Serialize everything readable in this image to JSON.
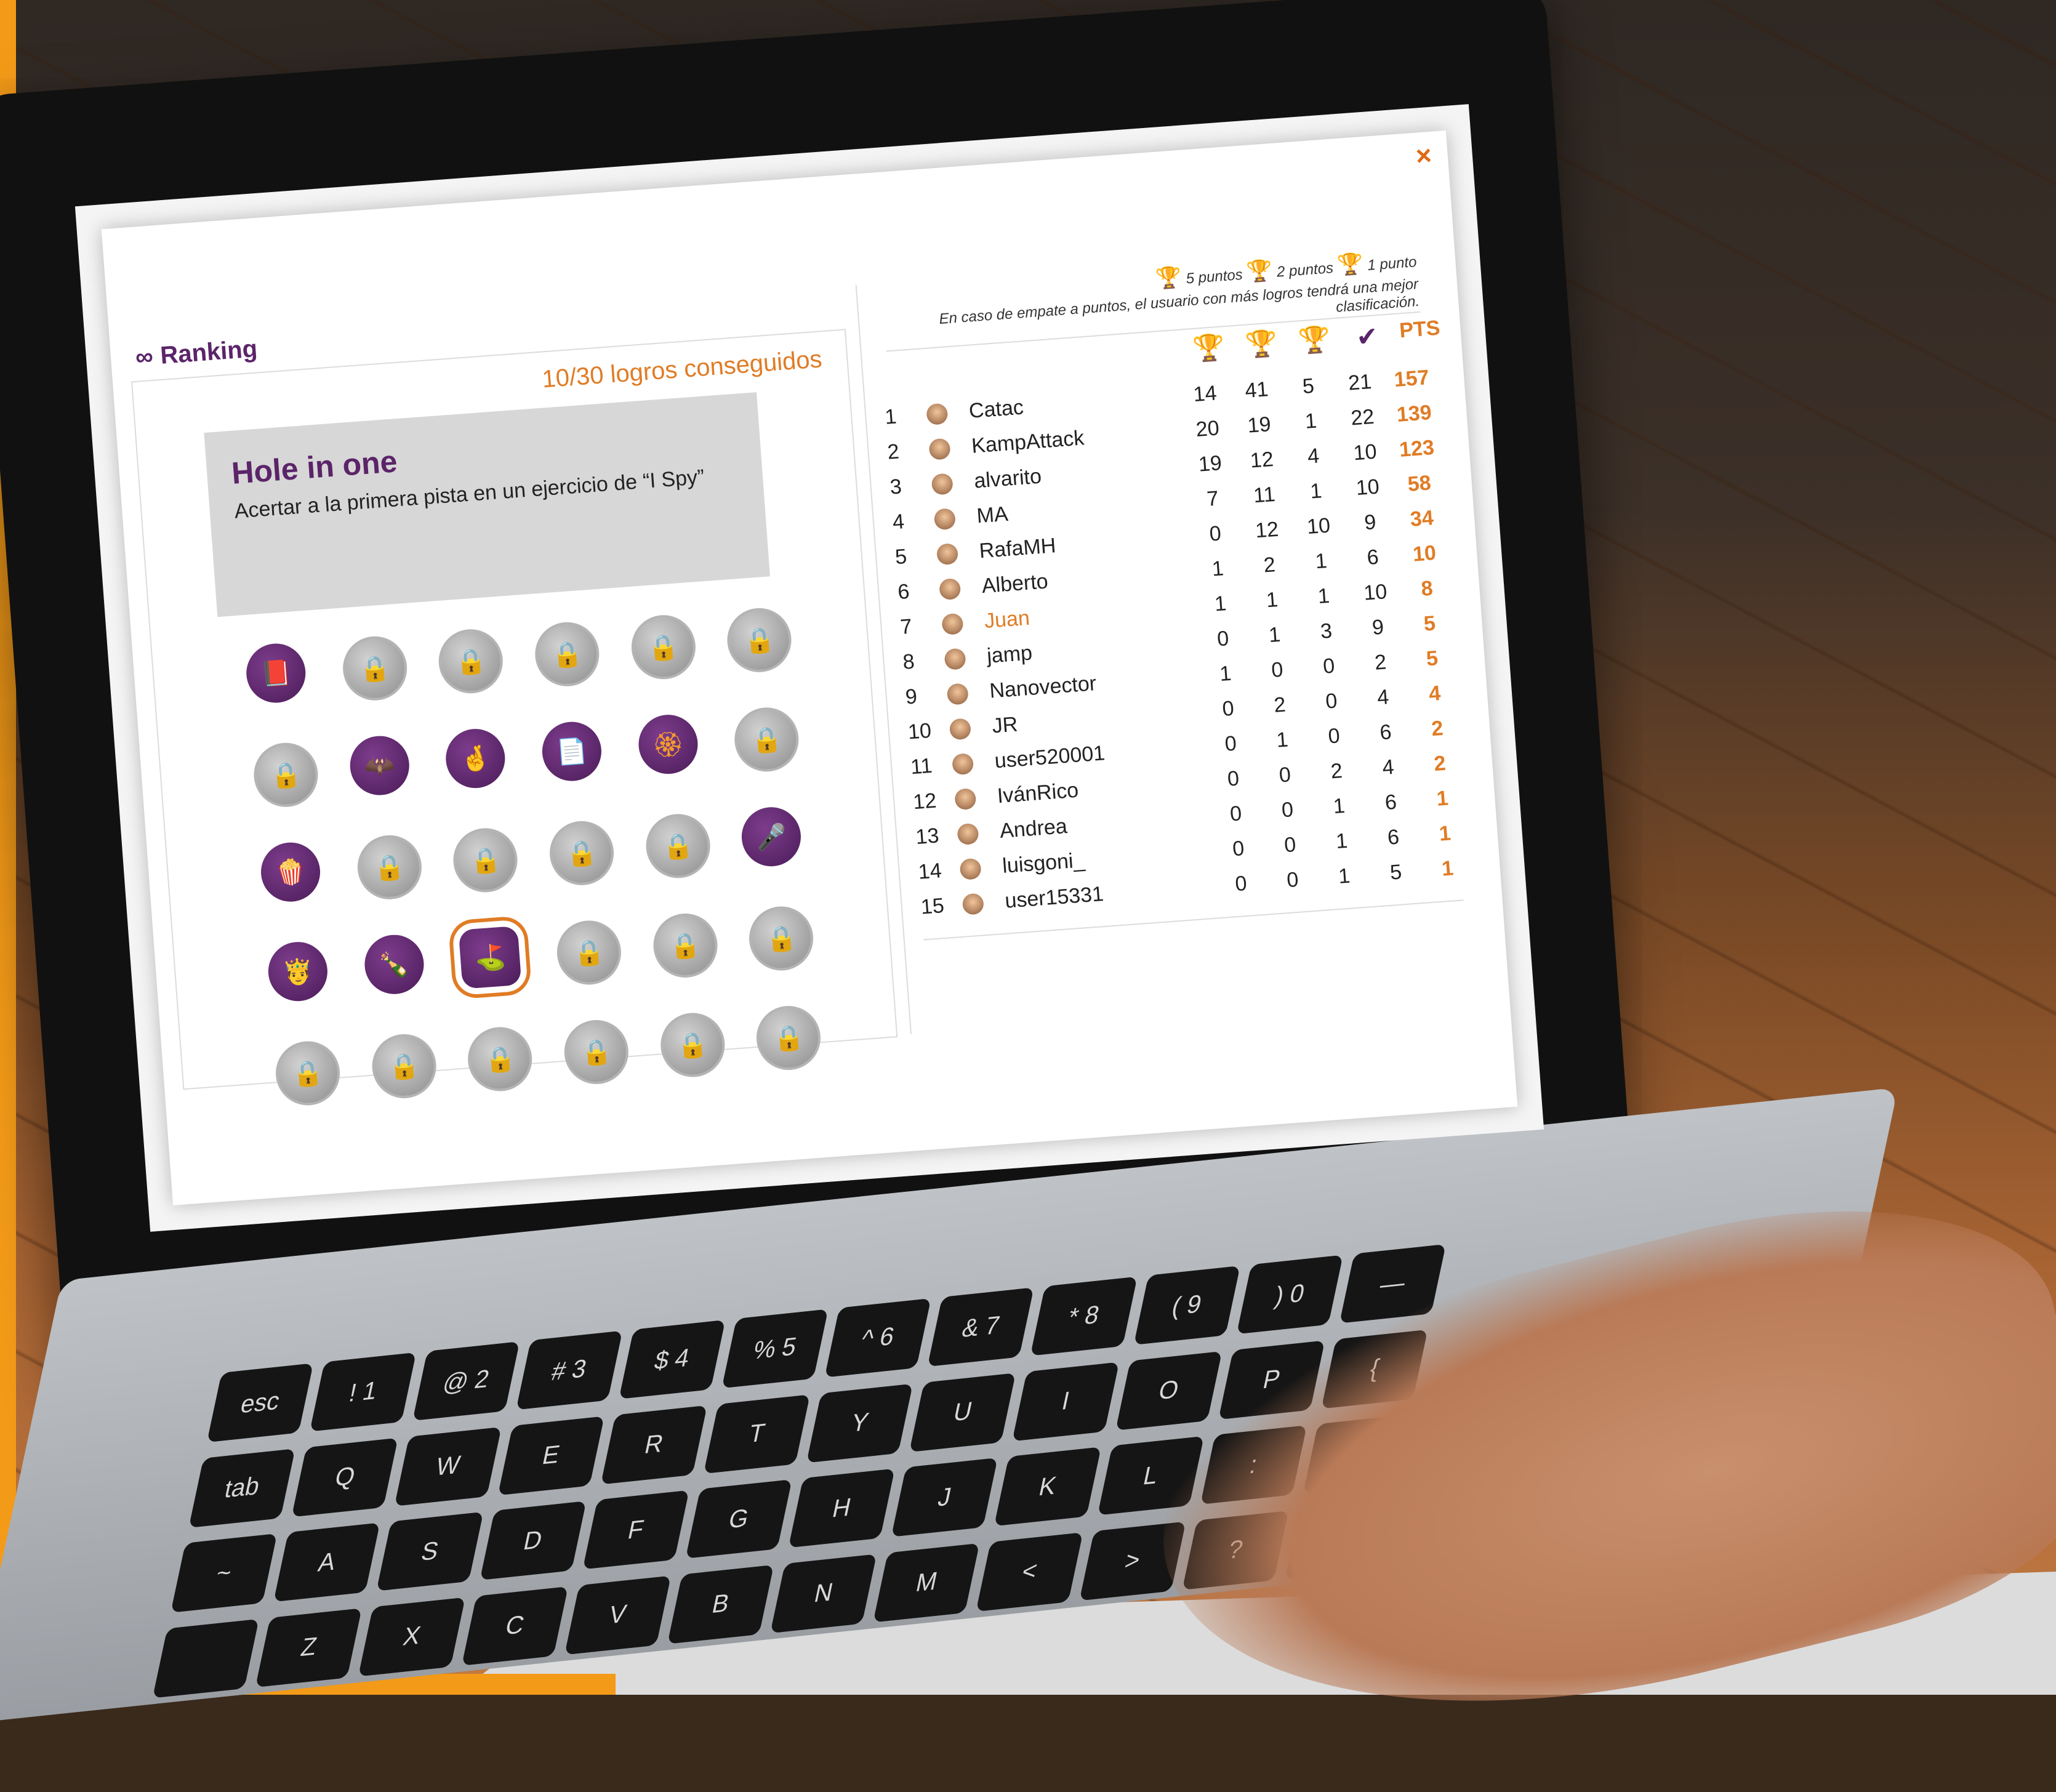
{
  "window": {
    "title": "Ranking",
    "close_icon": "×"
  },
  "achievements": {
    "count_label": "10/30 logros conseguidos",
    "selected": {
      "title": "Hole in one",
      "description": "Acertar a la primera pista en un ejercicio de “I Spy”"
    },
    "badges": [
      {
        "state": "earned",
        "icon": "book-icon",
        "glyph": "📕"
      },
      {
        "state": "locked",
        "icon": "lock-icon",
        "glyph": "🔒"
      },
      {
        "state": "locked",
        "icon": "lock-icon",
        "glyph": "🔒"
      },
      {
        "state": "locked",
        "icon": "lock-icon",
        "glyph": "🔒"
      },
      {
        "state": "locked",
        "icon": "lock-icon",
        "glyph": "🔒"
      },
      {
        "state": "locked",
        "icon": "lock-icon",
        "glyph": "🔒"
      },
      {
        "state": "locked",
        "icon": "lock-icon",
        "glyph": "🔒"
      },
      {
        "state": "earned",
        "icon": "mask-icon",
        "glyph": "🦇"
      },
      {
        "state": "earned",
        "icon": "fingers-crossed-icon",
        "glyph": "🤞"
      },
      {
        "state": "earned",
        "icon": "document-icon",
        "glyph": "📄"
      },
      {
        "state": "earned",
        "icon": "rosette-icon",
        "glyph": "🏵"
      },
      {
        "state": "locked",
        "icon": "lock-icon",
        "glyph": "🔒"
      },
      {
        "state": "earned",
        "icon": "popcorn-icon",
        "glyph": "🍿"
      },
      {
        "state": "locked",
        "icon": "lock-icon",
        "glyph": "🔒"
      },
      {
        "state": "locked",
        "icon": "lock-icon",
        "glyph": "🔒"
      },
      {
        "state": "locked",
        "icon": "lock-icon",
        "glyph": "🔒"
      },
      {
        "state": "locked",
        "icon": "lock-icon",
        "glyph": "🔒"
      },
      {
        "state": "earned",
        "icon": "microphone-icon",
        "glyph": "🎤"
      },
      {
        "state": "earned",
        "icon": "king-icon",
        "glyph": "🤴"
      },
      {
        "state": "earned",
        "icon": "bottle-icon",
        "glyph": "🍾"
      },
      {
        "state": "earned",
        "icon": "golf-flag-icon",
        "glyph": "⛳",
        "selected": true
      },
      {
        "state": "locked",
        "icon": "lock-icon",
        "glyph": "🔒"
      },
      {
        "state": "locked",
        "icon": "lock-icon",
        "glyph": "🔒"
      },
      {
        "state": "locked",
        "icon": "lock-icon",
        "glyph": "🔒"
      },
      {
        "state": "locked",
        "icon": "lock-icon",
        "glyph": "🔒"
      },
      {
        "state": "locked",
        "icon": "lock-icon",
        "glyph": "🔒"
      },
      {
        "state": "locked",
        "icon": "lock-icon",
        "glyph": "🔒"
      },
      {
        "state": "locked",
        "icon": "lock-icon",
        "glyph": "🔒"
      },
      {
        "state": "locked",
        "icon": "lock-icon",
        "glyph": "🔒"
      },
      {
        "state": "locked",
        "icon": "lock-icon",
        "glyph": "🔒"
      }
    ]
  },
  "ranking": {
    "legend": {
      "gold": "5 puntos",
      "silver": "2 puntos",
      "bronze": "1 punto",
      "note": "En caso de empate a puntos, el usuario con más logros tendrá una mejor clasificación."
    },
    "pts_header": "PTS",
    "rows": [
      {
        "rank": "1",
        "name": "Catac",
        "gold": "14",
        "silver": "41",
        "bronze": "5",
        "done": "21",
        "pts": "157"
      },
      {
        "rank": "2",
        "name": "KampAttack",
        "gold": "20",
        "silver": "19",
        "bronze": "1",
        "done": "22",
        "pts": "139"
      },
      {
        "rank": "3",
        "name": "alvarito",
        "gold": "19",
        "silver": "12",
        "bronze": "4",
        "done": "10",
        "pts": "123"
      },
      {
        "rank": "4",
        "name": "MA",
        "gold": "7",
        "silver": "11",
        "bronze": "1",
        "done": "10",
        "pts": "58"
      },
      {
        "rank": "5",
        "name": "RafaMH",
        "gold": "0",
        "silver": "12",
        "bronze": "10",
        "done": "9",
        "pts": "34"
      },
      {
        "rank": "6",
        "name": "Alberto",
        "gold": "1",
        "silver": "2",
        "bronze": "1",
        "done": "6",
        "pts": "10"
      },
      {
        "rank": "7",
        "name": "Juan",
        "gold": "1",
        "silver": "1",
        "bronze": "1",
        "done": "10",
        "pts": "8",
        "highlight": true
      },
      {
        "rank": "8",
        "name": "jamp",
        "gold": "0",
        "silver": "1",
        "bronze": "3",
        "done": "9",
        "pts": "5"
      },
      {
        "rank": "9",
        "name": "Nanovector",
        "gold": "1",
        "silver": "0",
        "bronze": "0",
        "done": "2",
        "pts": "5"
      },
      {
        "rank": "10",
        "name": "JR",
        "gold": "0",
        "silver": "2",
        "bronze": "0",
        "done": "4",
        "pts": "4"
      },
      {
        "rank": "11",
        "name": "user520001",
        "gold": "0",
        "silver": "1",
        "bronze": "0",
        "done": "6",
        "pts": "2"
      },
      {
        "rank": "12",
        "name": "IvánRico",
        "gold": "0",
        "silver": "0",
        "bronze": "2",
        "done": "4",
        "pts": "2"
      },
      {
        "rank": "13",
        "name": "Andrea",
        "gold": "0",
        "silver": "0",
        "bronze": "1",
        "done": "6",
        "pts": "1"
      },
      {
        "rank": "14",
        "name": "luisgoni_",
        "gold": "0",
        "silver": "0",
        "bronze": "1",
        "done": "6",
        "pts": "1"
      },
      {
        "rank": "15",
        "name": "user15331",
        "gold": "0",
        "silver": "0",
        "bronze": "1",
        "done": "5",
        "pts": "1"
      }
    ]
  },
  "keyboard": {
    "keys": [
      "esc",
      "!\n1",
      "@\n2",
      "#\n3",
      "$\n4",
      "%\n5",
      "^\n6",
      "&\n7",
      "*\n8",
      "(\n9",
      ")\n0",
      "—",
      "tab",
      "Q",
      "W",
      "E",
      "R",
      "T",
      "Y",
      "U",
      "I",
      "O",
      "P",
      "{",
      "~",
      "A",
      "S",
      "D",
      "F",
      "G",
      "H",
      "J",
      "K",
      "L",
      ":",
      "\"",
      "",
      "Z",
      "X",
      "C",
      "V",
      "B",
      "N",
      "M",
      "<",
      ">",
      "?",
      "⌘"
    ]
  },
  "colors": {
    "accent": "#e07c25",
    "brand": "#5b2469",
    "tab_strip": "#f39a18"
  }
}
